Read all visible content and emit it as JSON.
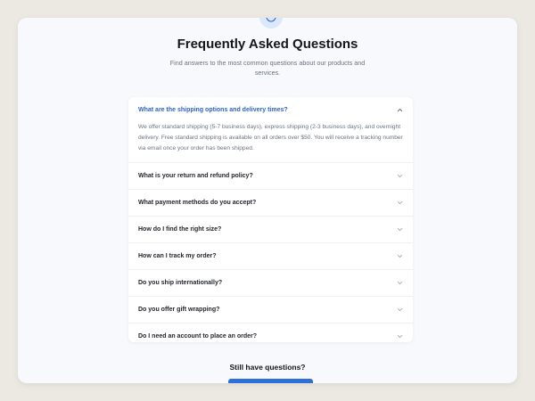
{
  "header": {
    "title": "Frequently Asked Questions",
    "subtitle": "Find answers to the most common questions about our products and services."
  },
  "faq": [
    {
      "question": "What are the shipping options and delivery times?",
      "open": true,
      "answer": "We offer standard shipping (5-7 business days), express shipping (2-3 business days), and overnight delivery. Free standard shipping is available on all orders over $50. You will receive a tracking number via email once your order has been shipped."
    },
    {
      "question": "What is your return and refund policy?",
      "open": false
    },
    {
      "question": "What payment methods do you accept?",
      "open": false
    },
    {
      "question": "How do I find the right size?",
      "open": false
    },
    {
      "question": "How can I track my order?",
      "open": false
    },
    {
      "question": "Do you ship internationally?",
      "open": false
    },
    {
      "question": "Do you offer gift wrapping?",
      "open": false
    },
    {
      "question": "Do I need an account to place an order?",
      "open": false
    }
  ],
  "footer": {
    "still_title": "Still have questions?",
    "button_label": ""
  },
  "icons": {
    "top": "help-circle-icon",
    "open": "chevron-up-icon",
    "closed": "chevron-down-icon"
  },
  "colors": {
    "accent": "#2d63c8",
    "button": "#2f6fd8",
    "background": "#ece9e3",
    "card": "#f7f9fc"
  }
}
